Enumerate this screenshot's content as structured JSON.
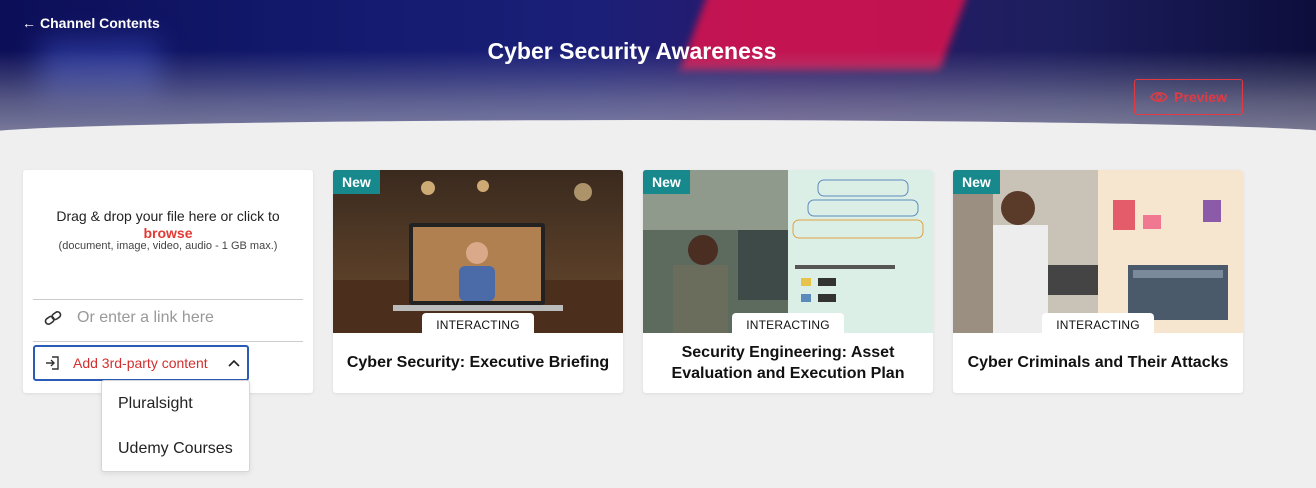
{
  "header": {
    "back_label": "Channel Contents",
    "title": "Cyber Security Awareness",
    "preview_label": "Preview"
  },
  "upload": {
    "drag_text": "Drag & drop your file here or click to",
    "browse_label": "browse",
    "hint": "(document, image, video, audio - 1 GB max.)",
    "link_placeholder": "Or enter a link here",
    "third_party_label": "Add 3rd-party content"
  },
  "third_party_options": [
    "Pluralsight",
    "Udemy Courses"
  ],
  "cards": [
    {
      "badge": "New",
      "status": "INTERACTING",
      "title": "Cyber Security: Executive Briefing"
    },
    {
      "badge": "New",
      "status": "INTERACTING",
      "title": "Security Engineering: Asset Evaluation and Execution Plan"
    },
    {
      "badge": "New",
      "status": "INTERACTING",
      "title": "Cyber Criminals and Their Attacks"
    }
  ],
  "colors": {
    "accent": "#e53935",
    "badge": "#17888c",
    "focus": "#2a5bb5"
  }
}
